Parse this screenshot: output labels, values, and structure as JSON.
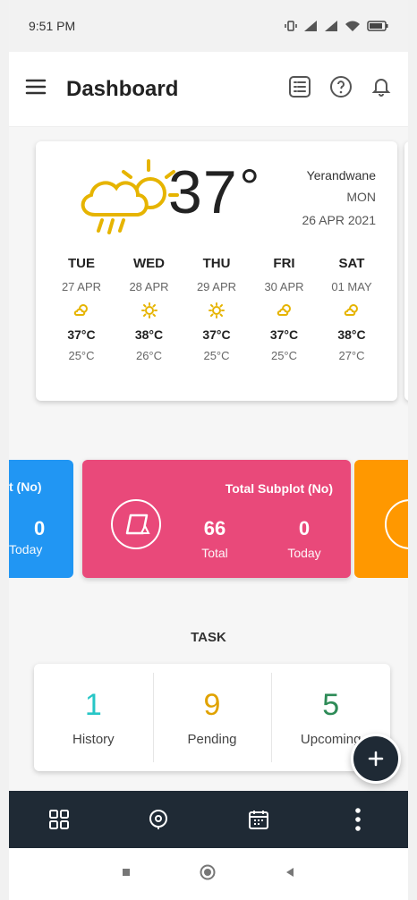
{
  "status_bar": {
    "time": "9:51 PM"
  },
  "app_bar": {
    "title": "Dashboard"
  },
  "weather": {
    "temperature": "37",
    "degree_symbol": "°",
    "location": "Yerandwane",
    "day": "MON",
    "date": "26 APR 2021",
    "forecast": [
      {
        "day": "TUE",
        "date": "27 APR",
        "icon": "cloud-sun-icon",
        "high": "37°C",
        "low": "25°C"
      },
      {
        "day": "WED",
        "date": "28 APR",
        "icon": "sun-icon",
        "high": "38°C",
        "low": "26°C"
      },
      {
        "day": "THU",
        "date": "29 APR",
        "icon": "sun-icon",
        "high": "37°C",
        "low": "25°C"
      },
      {
        "day": "FRI",
        "date": "30 APR",
        "icon": "cloud-sun-icon",
        "high": "37°C",
        "low": "25°C"
      },
      {
        "day": "SAT",
        "date": "01 MAY",
        "icon": "cloud-sun-icon",
        "high": "38°C",
        "low": "27°C"
      }
    ]
  },
  "stats": {
    "left_peek": {
      "title": "t (No)",
      "value": "0",
      "label": "Today",
      "color": "#2196f3"
    },
    "subplot": {
      "title": "Total Subplot (No)",
      "total_value": "66",
      "total_label": "Total",
      "today_value": "0",
      "today_label": "Today",
      "color": "#e9497a"
    },
    "right_peek": {
      "color": "#ff9800"
    }
  },
  "task": {
    "title": "TASK",
    "items": [
      {
        "value": "1",
        "label": "History",
        "color": "#26c6c6"
      },
      {
        "value": "9",
        "label": "Pending",
        "color": "#e0a200"
      },
      {
        "value": "5",
        "label": "Upcoming",
        "color": "#2e8b57"
      }
    ]
  },
  "colors": {
    "accent_dark": "#1f2a35",
    "weather_icon": "#e6b400"
  }
}
